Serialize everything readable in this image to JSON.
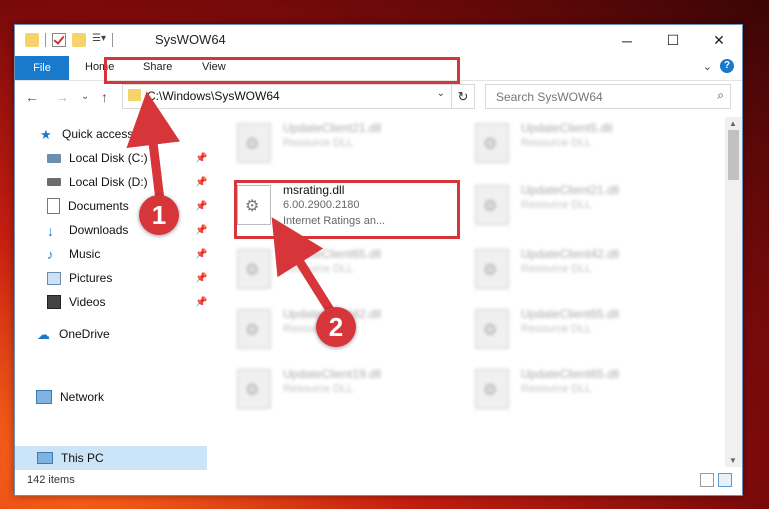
{
  "window": {
    "title": "SysWOW64",
    "minimize_glyph": "─",
    "maximize_glyph": "☐",
    "close_glyph": "✕"
  },
  "ribbon": {
    "tabs": [
      "File",
      "Home",
      "Share",
      "View"
    ],
    "help_glyph": "?",
    "expand_glyph": "⌄"
  },
  "nav": {
    "back_glyph": "←",
    "forward_glyph": "→",
    "recent_glyph": "⌄",
    "up_glyph": "↑",
    "address": "C:\\Windows\\SysWOW64",
    "address_dropdown_glyph": "⌄",
    "refresh_glyph": "↻",
    "search_placeholder": "Search SysWOW64",
    "search_glyph": "⌕"
  },
  "sidebar": {
    "items": [
      {
        "label": "Quick access",
        "icon": "star-icon"
      },
      {
        "label": "Local Disk (C:)",
        "icon": "drive-icon"
      },
      {
        "label": "Local Disk (D:)",
        "icon": "drive-icon"
      },
      {
        "label": "Documents",
        "icon": "documents-icon"
      },
      {
        "label": "Downloads",
        "icon": "downloads-icon"
      },
      {
        "label": "Music",
        "icon": "music-icon"
      },
      {
        "label": "Pictures",
        "icon": "pictures-icon"
      },
      {
        "label": "Videos",
        "icon": "videos-icon"
      },
      {
        "label": "OneDrive",
        "icon": "cloud-icon"
      },
      {
        "label": "This PC",
        "icon": "computer-icon"
      },
      {
        "label": "Network",
        "icon": "network-icon"
      }
    ],
    "pin_glyph": "📌"
  },
  "files": {
    "left": [
      {
        "name": "UpdateClient21.dll",
        "type": "Resource DLL"
      },
      {
        "name": "msrating.dll",
        "version": "6.00.2900.2180",
        "desc": "Internet Ratings an..."
      },
      {
        "name": "UpdateClient65.dll",
        "type": "Resource DLL"
      },
      {
        "name": "UpdateClient42.dll",
        "type": "Resource DLL"
      },
      {
        "name": "UpdateClient19.dll",
        "type": "Resource DLL"
      }
    ],
    "right": [
      {
        "name": "UpdateClient5.dll",
        "type": "Resource DLL"
      },
      {
        "name": "UpdateClient21.dll",
        "type": "Resource DLL"
      },
      {
        "name": "UpdateClient42.dll",
        "type": "Resource DLL"
      },
      {
        "name": "UpdateClient65.dll",
        "type": "Resource DLL"
      },
      {
        "name": "UpdateClient65.dll",
        "type": "Resource DLL"
      }
    ]
  },
  "status": {
    "count": "142 items"
  },
  "callouts": {
    "one": "1",
    "two": "2"
  },
  "colors": {
    "accent": "#1979ca",
    "highlight": "#d6363a",
    "selected": "#cce4f7"
  }
}
